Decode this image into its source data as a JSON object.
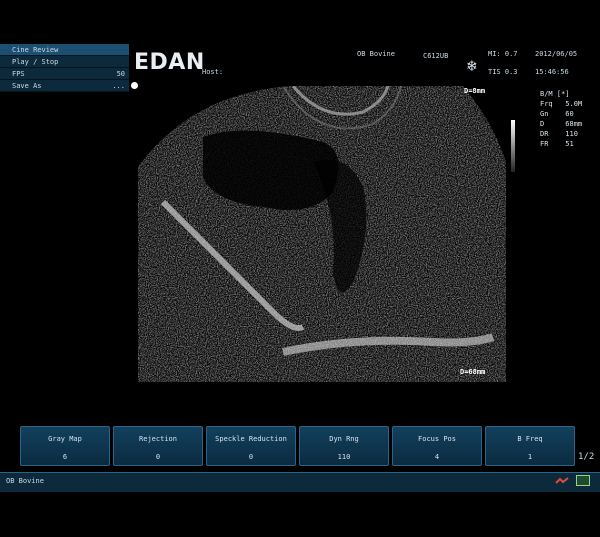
{
  "cine_menu": {
    "items": [
      {
        "label": "Cine Review",
        "value": ""
      },
      {
        "label": "Play / Stop",
        "value": ""
      },
      {
        "label": "FPS",
        "value": "50"
      },
      {
        "label": "Save As",
        "value": "..."
      }
    ]
  },
  "header": {
    "logo": "EDAN",
    "host_label": "Host:",
    "exam": "OB Bovine",
    "probe": "C612UB",
    "mi": "MI: 0.7",
    "tis": "TIS 0.3",
    "date": "2012/06/05",
    "time": "15:46:56"
  },
  "image": {
    "depth_top": "D=8mm",
    "depth_bottom": "D=68mm"
  },
  "params": {
    "mode": "B/M [*]",
    "rows": [
      "Frq   5.0M",
      "Gn    60",
      "D     68mm",
      "DR    110",
      "FR    51"
    ]
  },
  "softkeys": [
    {
      "label": "Gray Map",
      "value": "6"
    },
    {
      "label": "Rejection",
      "value": "0"
    },
    {
      "label": "Speckle Reduction",
      "value": "0"
    },
    {
      "label": "Dyn Rng",
      "value": "110"
    },
    {
      "label": "Focus Pos",
      "value": "4"
    },
    {
      "label": "B Freq",
      "value": "1"
    }
  ],
  "page_indicator": "1/2",
  "status": {
    "text": "OB Bovine"
  },
  "colors": {
    "panel": "#0d2a3d",
    "panel_active": "#1c4f70",
    "softkey_border": "#2b6486"
  }
}
